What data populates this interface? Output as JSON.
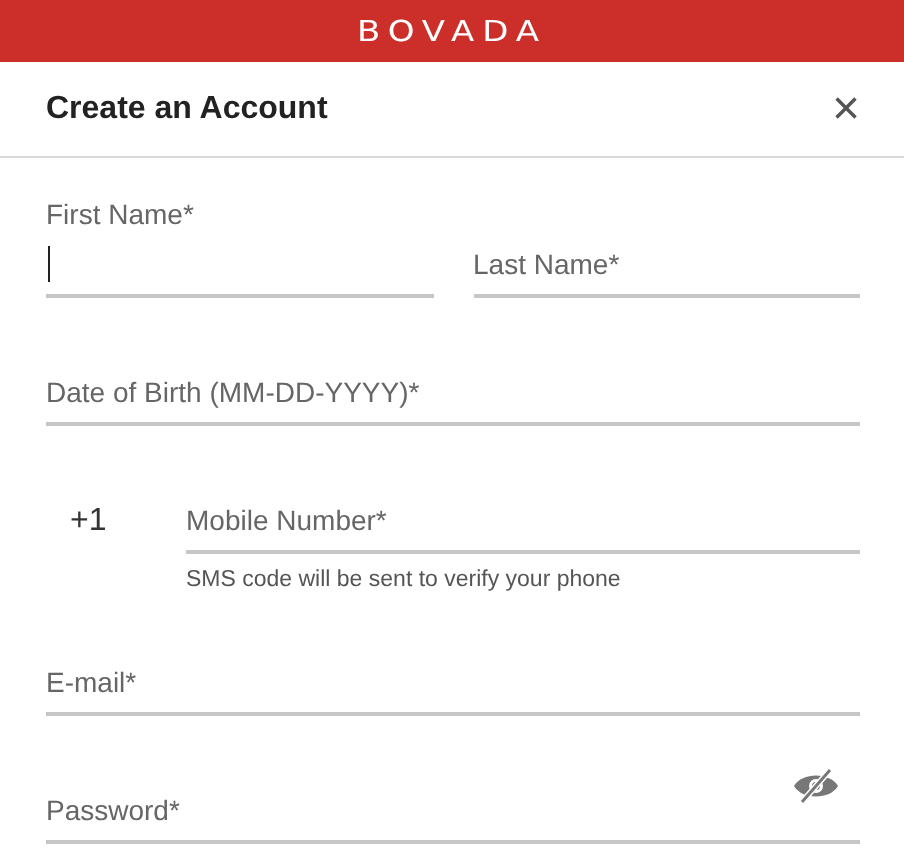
{
  "brand": {
    "logo": "BOVADA"
  },
  "dialog": {
    "title": "Create an Account",
    "close": "×"
  },
  "name_row": [
    {
      "label": "First Name*",
      "focused": true
    },
    {
      "placeholder": "Last Name*",
      "focused": false
    }
  ],
  "fields": [
    {
      "kind": "text",
      "placeholder": "Date of Birth (MM-DD-YYYY)*"
    },
    {
      "kind": "phone",
      "placeholder": "Mobile Number*",
      "prefix": "+1",
      "hint": "SMS code will be sent to verify your phone"
    },
    {
      "kind": "text",
      "placeholder": "E-mail*"
    },
    {
      "kind": "password",
      "placeholder": "Password*"
    }
  ]
}
